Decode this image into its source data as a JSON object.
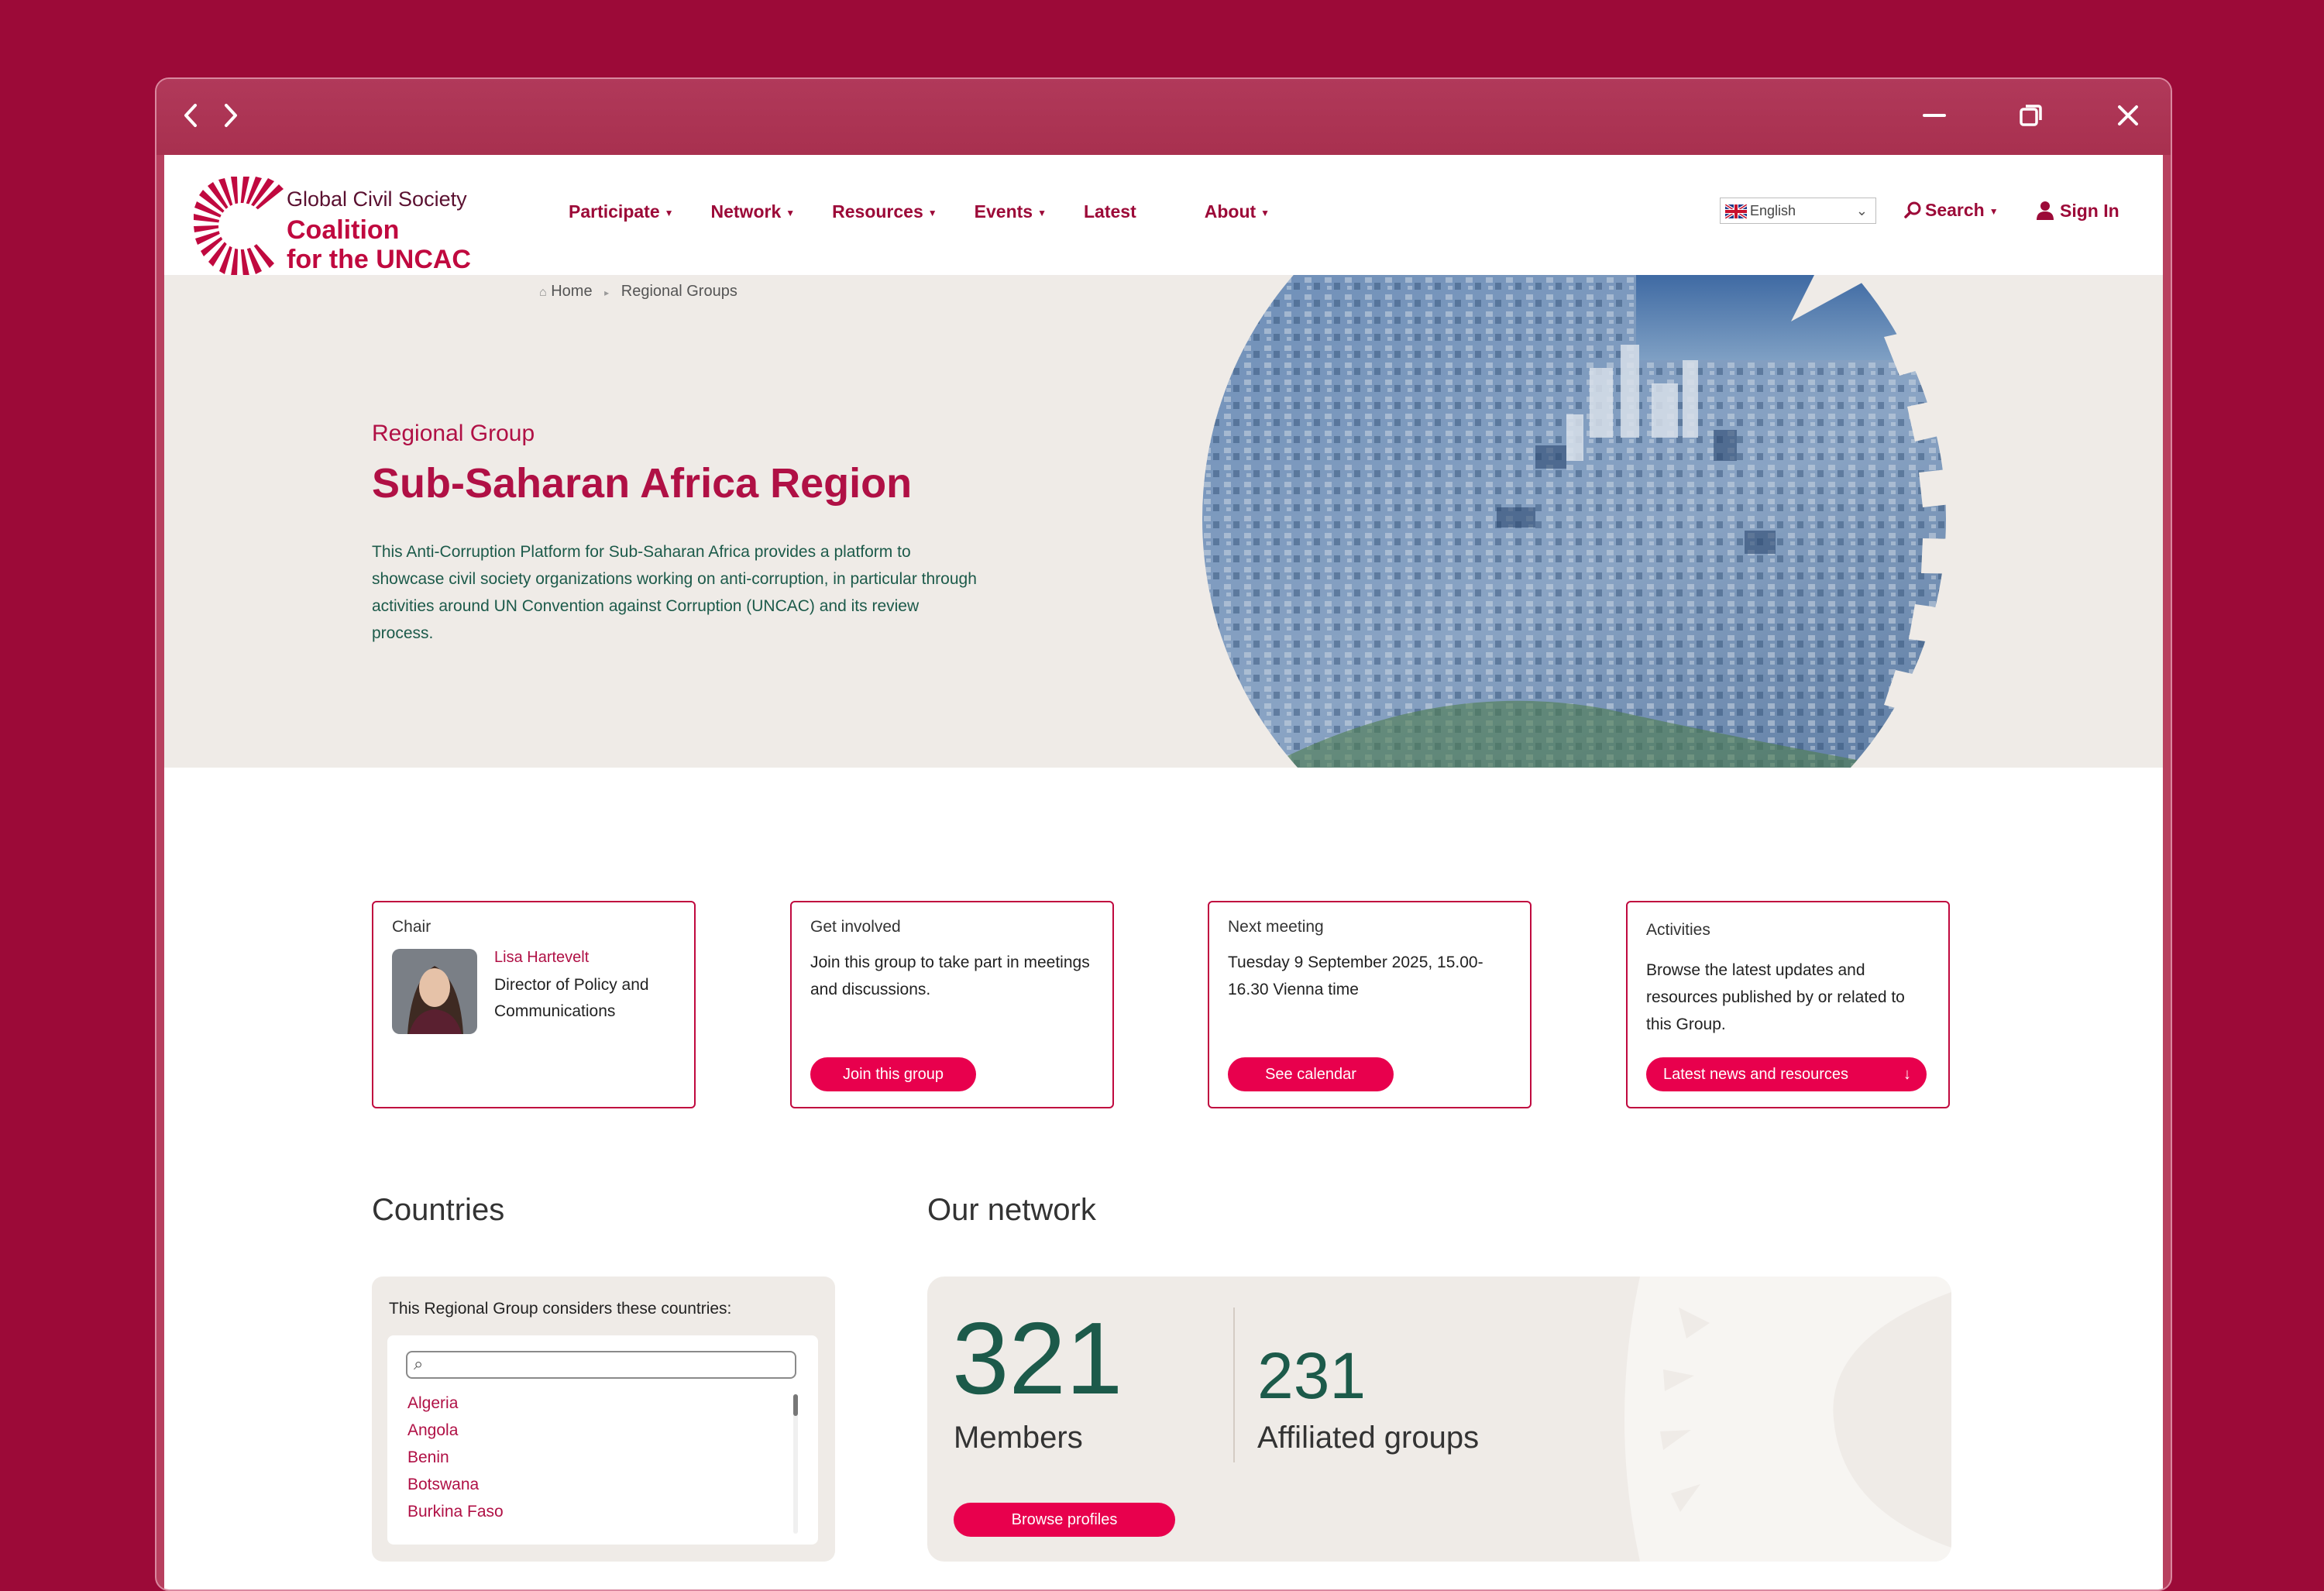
{
  "window": {
    "back_icon": "chevron-left-icon",
    "forward_icon": "chevron-right-icon",
    "minimize_icon": "minimize-icon",
    "restore_icon": "restore-icon",
    "close_icon": "close-icon"
  },
  "brand": {
    "line1": "Global Civil Society",
    "line2": "Coalition",
    "line3": "for the UNCAC",
    "accent_color": "#c0093f"
  },
  "nav": {
    "items": [
      {
        "label": "Participate",
        "has_menu": true
      },
      {
        "label": "Network",
        "has_menu": true
      },
      {
        "label": "Resources",
        "has_menu": true
      },
      {
        "label": "Events",
        "has_menu": true
      },
      {
        "label": "Latest",
        "has_menu": false
      },
      {
        "label": "About",
        "has_menu": true
      }
    ],
    "language": "English",
    "search_label": "Search",
    "signin_label": "Sign In"
  },
  "breadcrumb": {
    "home": "Home",
    "current": "Regional Groups"
  },
  "hero": {
    "eyebrow": "Regional Group",
    "title": "Sub-Saharan Africa Region",
    "intro": "This Anti-Corruption Platform for Sub-Saharan Africa provides a platform to showcase civil society organizations working on anti-corruption, in particular through activities around UN Convention against Corruption (UNCAC) and its review process."
  },
  "cards": {
    "chair": {
      "label": "Chair",
      "name": "Lisa Hartevelt",
      "role": "Director of Policy and Communications"
    },
    "get_involved": {
      "label": "Get involved",
      "text": "Join this group to take part in meetings and discussions.",
      "button": "Join this group"
    },
    "next_meeting": {
      "label": "Next meeting",
      "text": "Tuesday 9 September 2025, 15.00-16.30 Vienna time",
      "button": "See calendar"
    },
    "activities": {
      "label": "Activities",
      "text": "Browse the latest updates and resources published by or related to this Group.",
      "button": "Latest news and resources",
      "button_icon": "arrow-down-icon"
    }
  },
  "countries": {
    "heading": "Countries",
    "intro": "This Regional Group considers these countries:",
    "search_placeholder": "",
    "items": [
      "Algeria",
      "Angola",
      "Benin",
      "Botswana",
      "Burkina Faso"
    ]
  },
  "network": {
    "heading": "Our network",
    "members_count": "321",
    "members_label": "Members",
    "groups_count": "231",
    "groups_label": "Affiliated groups",
    "button": "Browse profiles"
  }
}
